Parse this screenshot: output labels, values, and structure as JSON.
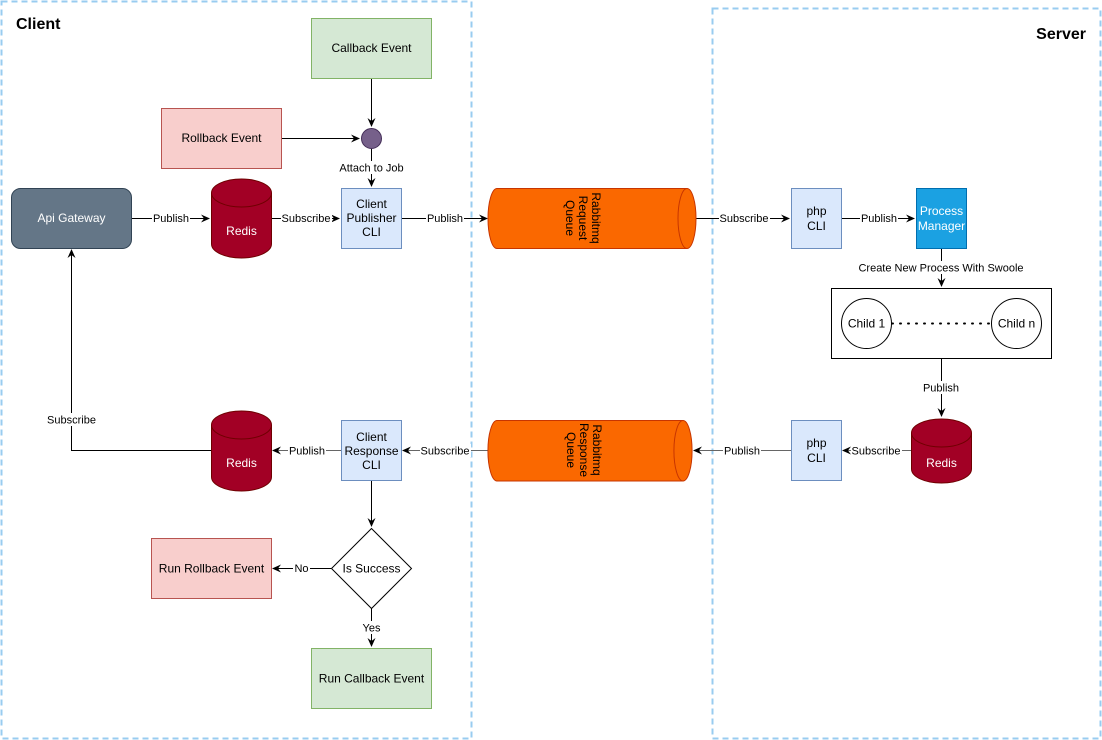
{
  "groups": {
    "client": {
      "title": "Client"
    },
    "server": {
      "title": "Server"
    }
  },
  "nodes": {
    "callback_event": {
      "label": "Callback Event"
    },
    "rollback_event": {
      "label": "Rollback Event"
    },
    "api_gateway": {
      "label": "Api Gateway"
    },
    "client_redis": {
      "label": "Redis"
    },
    "client_publisher_cli": {
      "lines": [
        "Client",
        "Publisher",
        "CLI"
      ]
    },
    "rabbitmq_request_queue": {
      "lines": [
        "Rabbitmq",
        "Request",
        "Queue"
      ]
    },
    "php_cli_request": {
      "lines": [
        "php",
        "CLI"
      ]
    },
    "process_manager": {
      "lines": [
        "Process",
        "Manager"
      ]
    },
    "child_1": {
      "label": "Child 1"
    },
    "child_n": {
      "label": "Child n"
    },
    "server_redis": {
      "label": "Redis"
    },
    "php_cli_response": {
      "lines": [
        "php",
        "CLI"
      ]
    },
    "rabbitmq_response_queue": {
      "lines": [
        "Rabbitmq",
        "Response",
        "Queue"
      ]
    },
    "client_response_cli": {
      "lines": [
        "Client",
        "Response",
        "CLI"
      ]
    },
    "client_redis_response": {
      "label": "Redis"
    },
    "is_success": {
      "label": "Is Success"
    },
    "run_rollback_event": {
      "label": "Run Rollback Event"
    },
    "run_callback_event": {
      "label": "Run Callback Event"
    }
  },
  "edges": {
    "attach_to_job": "Attach to Job",
    "gateway_to_redis": "Publish",
    "redis_to_publisher": "Subscribe",
    "publisher_to_queue": "Publish",
    "queue_to_php": "Subscribe",
    "php_to_manager": "Publish",
    "manager_to_children": "Create New Process With Swoole",
    "children_to_redis": "Publish",
    "redis_to_php": "Subscribe",
    "php_to_response_queue": "Publish",
    "response_queue_to_cli": "Subscribe",
    "cli_to_redis": "Publish",
    "redis_to_gateway": "Subscribe",
    "decision_no": "No",
    "decision_yes": "Yes"
  },
  "colors": {
    "group_border": "#99ccf0",
    "green_fill": "#d5e8d4",
    "green_stroke": "#82b366",
    "red_fill": "#f8cecc",
    "red_stroke": "#b85450",
    "gateway_fill": "#647687",
    "gateway_stroke": "#314354",
    "redis_fill": "#a20025",
    "redis_stroke": "#6f0000",
    "blue_fill": "#dae8fc",
    "blue_stroke": "#6c8ebf",
    "queue_fill": "#fa6800",
    "queue_stroke": "#c73500",
    "manager_fill": "#1ba1e2",
    "manager_stroke": "#006eaf",
    "junction_fill": "#76608a",
    "junction_stroke": "#432d57"
  }
}
